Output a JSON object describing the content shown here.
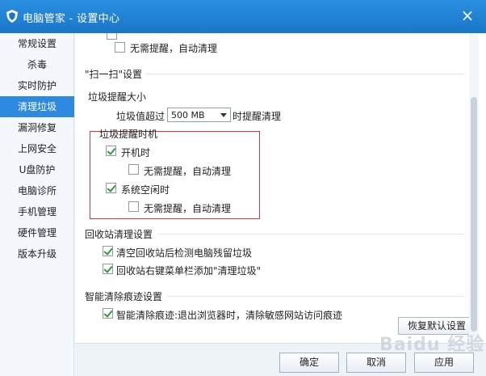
{
  "window": {
    "title": "电脑管家 - 设置中心",
    "close_symbol": "×",
    "logo_icon": "shield-logo-icon"
  },
  "sidebar": {
    "items": [
      {
        "label": "常规设置",
        "active": false
      },
      {
        "label": "杀毒",
        "active": false
      },
      {
        "label": "实时防护",
        "active": false
      },
      {
        "label": "清理垃圾",
        "active": true
      },
      {
        "label": "漏洞修复",
        "active": false
      },
      {
        "label": "上网安全",
        "active": false
      },
      {
        "label": "U盘防护",
        "active": false
      },
      {
        "label": "电脑诊所",
        "active": false
      },
      {
        "label": "手机管理",
        "active": false
      },
      {
        "label": "硬件管理",
        "active": false
      },
      {
        "label": "版本升级",
        "active": false
      }
    ]
  },
  "content": {
    "top_partial_option": {
      "label": "无需提醒，自动清理",
      "checked": false
    },
    "scan_section": {
      "title": "\"扫一扫\"设置",
      "size_group": {
        "title": "垃圾提醒大小",
        "prefix": "垃圾值超过",
        "select_value": "500 MB",
        "suffix": "时提醒清理"
      },
      "timing_group": {
        "title": "垃圾提醒时机",
        "boot": {
          "label": "开机时",
          "checked": true
        },
        "boot_auto": {
          "label": "无需提醒，自动清理",
          "checked": false
        },
        "idle": {
          "label": "系统空闲时",
          "checked": true
        },
        "idle_auto": {
          "label": "无需提醒，自动清理",
          "checked": false
        }
      }
    },
    "recycle_section": {
      "title": "回收站清理设置",
      "option1": {
        "label": "清空回收站后检测电脑残留垃圾",
        "checked": true
      },
      "option2": {
        "label": "回收站右键菜单栏添加\"清理垃圾\"",
        "checked": true
      }
    },
    "traces_section": {
      "title": "智能清除痕迹设置",
      "option1": {
        "label": "智能清除痕迹:退出浏览器时，清除敏感网站访问痕迹",
        "checked": true
      }
    },
    "restore_button": "恢复默认设置"
  },
  "footer": {
    "ok": "确定",
    "cancel": "取消",
    "apply": "应用"
  },
  "watermark": "Baidu 经验",
  "colors": {
    "accent": "#2d8ae0",
    "titlebar": "#1a76c9",
    "highlight_border": "#d9363e"
  }
}
